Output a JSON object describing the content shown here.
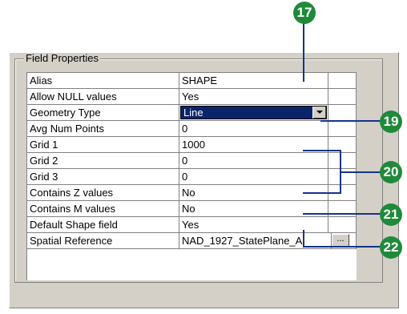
{
  "group_title": "Field Properties",
  "rows": [
    {
      "name": "Alias",
      "value": "SHAPE"
    },
    {
      "name": "Allow NULL values",
      "value": "Yes"
    },
    {
      "name": "Geometry Type",
      "value": "Line"
    },
    {
      "name": "Avg Num Points",
      "value": "0"
    },
    {
      "name": "Grid 1",
      "value": "1000"
    },
    {
      "name": "Grid 2",
      "value": "0"
    },
    {
      "name": "Grid 3",
      "value": "0"
    },
    {
      "name": "Contains Z values",
      "value": "No"
    },
    {
      "name": "Contains M values",
      "value": "No"
    },
    {
      "name": "Default Shape field",
      "value": "Yes"
    },
    {
      "name": "Spatial Reference",
      "value": "NAD_1927_StatePlane_Al"
    }
  ],
  "ellipsis_label": "...",
  "callouts": {
    "c17": "17",
    "c19": "19",
    "c20": "20",
    "c21": "21",
    "c22": "22"
  },
  "colors": {
    "callout": "#1f8a3a",
    "leader_line": "#13338c",
    "selection": "#0a246a"
  }
}
